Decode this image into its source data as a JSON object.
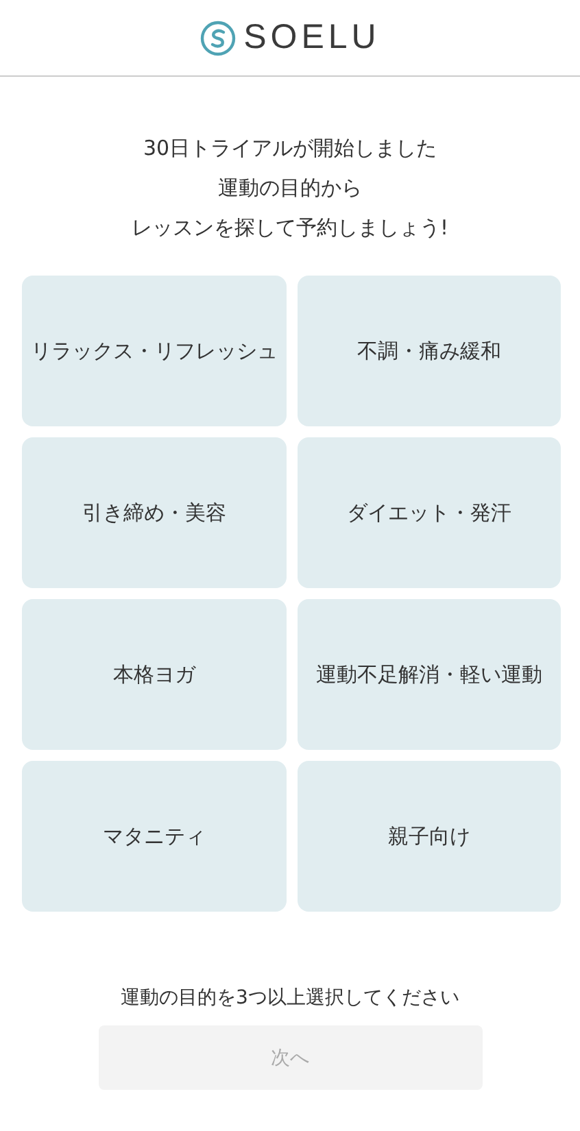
{
  "header": {
    "logo_text": "SOELU"
  },
  "intro": [
    "30日トライアルが開始しました",
    "運動の目的から",
    "レッスンを探して予約しましょう!"
  ],
  "purposes": [
    {
      "label": "リラックス・リフレッシュ",
      "selected": false
    },
    {
      "label": "不調・痛み緩和",
      "selected": false
    },
    {
      "label": "引き締め・美容",
      "selected": false
    },
    {
      "label": "ダイエット・発汗",
      "selected": false
    },
    {
      "label": "本格ヨガ",
      "selected": false
    },
    {
      "label": "運動不足解消・軽い運動",
      "selected": false
    },
    {
      "label": "マタニティ",
      "selected": false
    },
    {
      "label": "親子向け",
      "selected": false
    }
  ],
  "hint": "運動の目的を3つ以上選択してください",
  "next_button": {
    "label": "次へ",
    "disabled": true
  }
}
